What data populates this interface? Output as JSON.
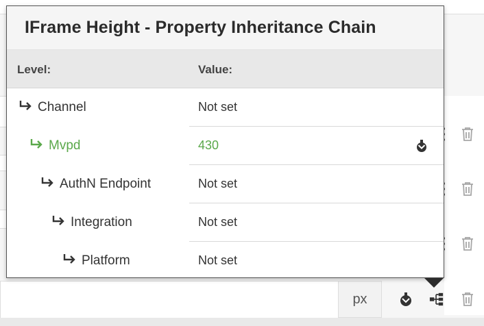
{
  "popover": {
    "title": "IFrame Height - Property Inheritance Chain",
    "columns": {
      "level": "Level:",
      "value": "Value:"
    },
    "rows": [
      {
        "level": "Channel",
        "value": "Not set",
        "active": false
      },
      {
        "level": "Mvpd",
        "value": "430",
        "active": true
      },
      {
        "level": "AuthN Endpoint",
        "value": "Not set",
        "active": false
      },
      {
        "level": "Integration",
        "value": "Not set",
        "active": false
      },
      {
        "level": "Platform",
        "value": "Not set",
        "active": false
      }
    ]
  },
  "field": {
    "unit": "px"
  },
  "colors": {
    "active": "#5aa84a",
    "header": "#f5f5f5",
    "column_header": "#e8e8e8"
  },
  "icons": [
    "inherit-arrow-icon",
    "override-icon",
    "inheritance-chain-icon",
    "trash-icon",
    "drag-handle-icon"
  ]
}
